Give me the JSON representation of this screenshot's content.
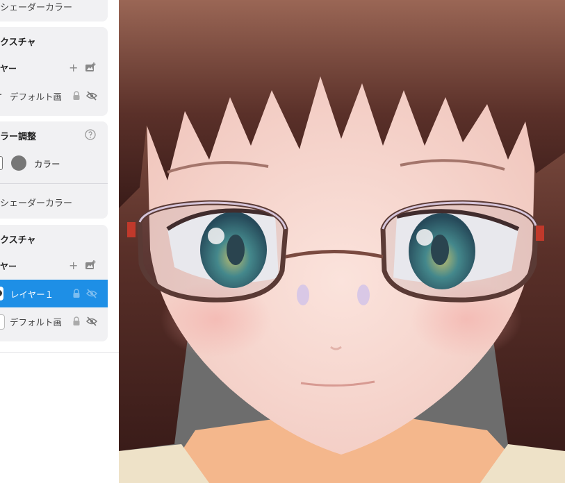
{
  "panel": {
    "shader_color_top": "シェーダーカラー",
    "texture_1": {
      "title": "クスチャ",
      "layer_header": "ヤー",
      "layers": [
        {
          "name": "デフォルト画"
        }
      ]
    },
    "color_adjust": {
      "title": "ラー調整",
      "color_label": "カラー"
    },
    "shader_color_2": "シェーダーカラー",
    "texture_2": {
      "title": "クスチャ",
      "layer_header": "ヤー",
      "layers": [
        {
          "name": "レイヤー１",
          "selected": true
        },
        {
          "name": "デフォルト画"
        }
      ]
    }
  },
  "icons": {
    "add": "plus-icon",
    "add_image": "add-image-icon",
    "lock": "lock-icon",
    "hidden": "eye-off-icon",
    "help": "help-circle-icon"
  },
  "colors": {
    "selection": "#1e8fe6",
    "card_bg": "#f1f1f3",
    "color_swatch": "#777777",
    "viewport_bg": "#6d6d6d"
  }
}
